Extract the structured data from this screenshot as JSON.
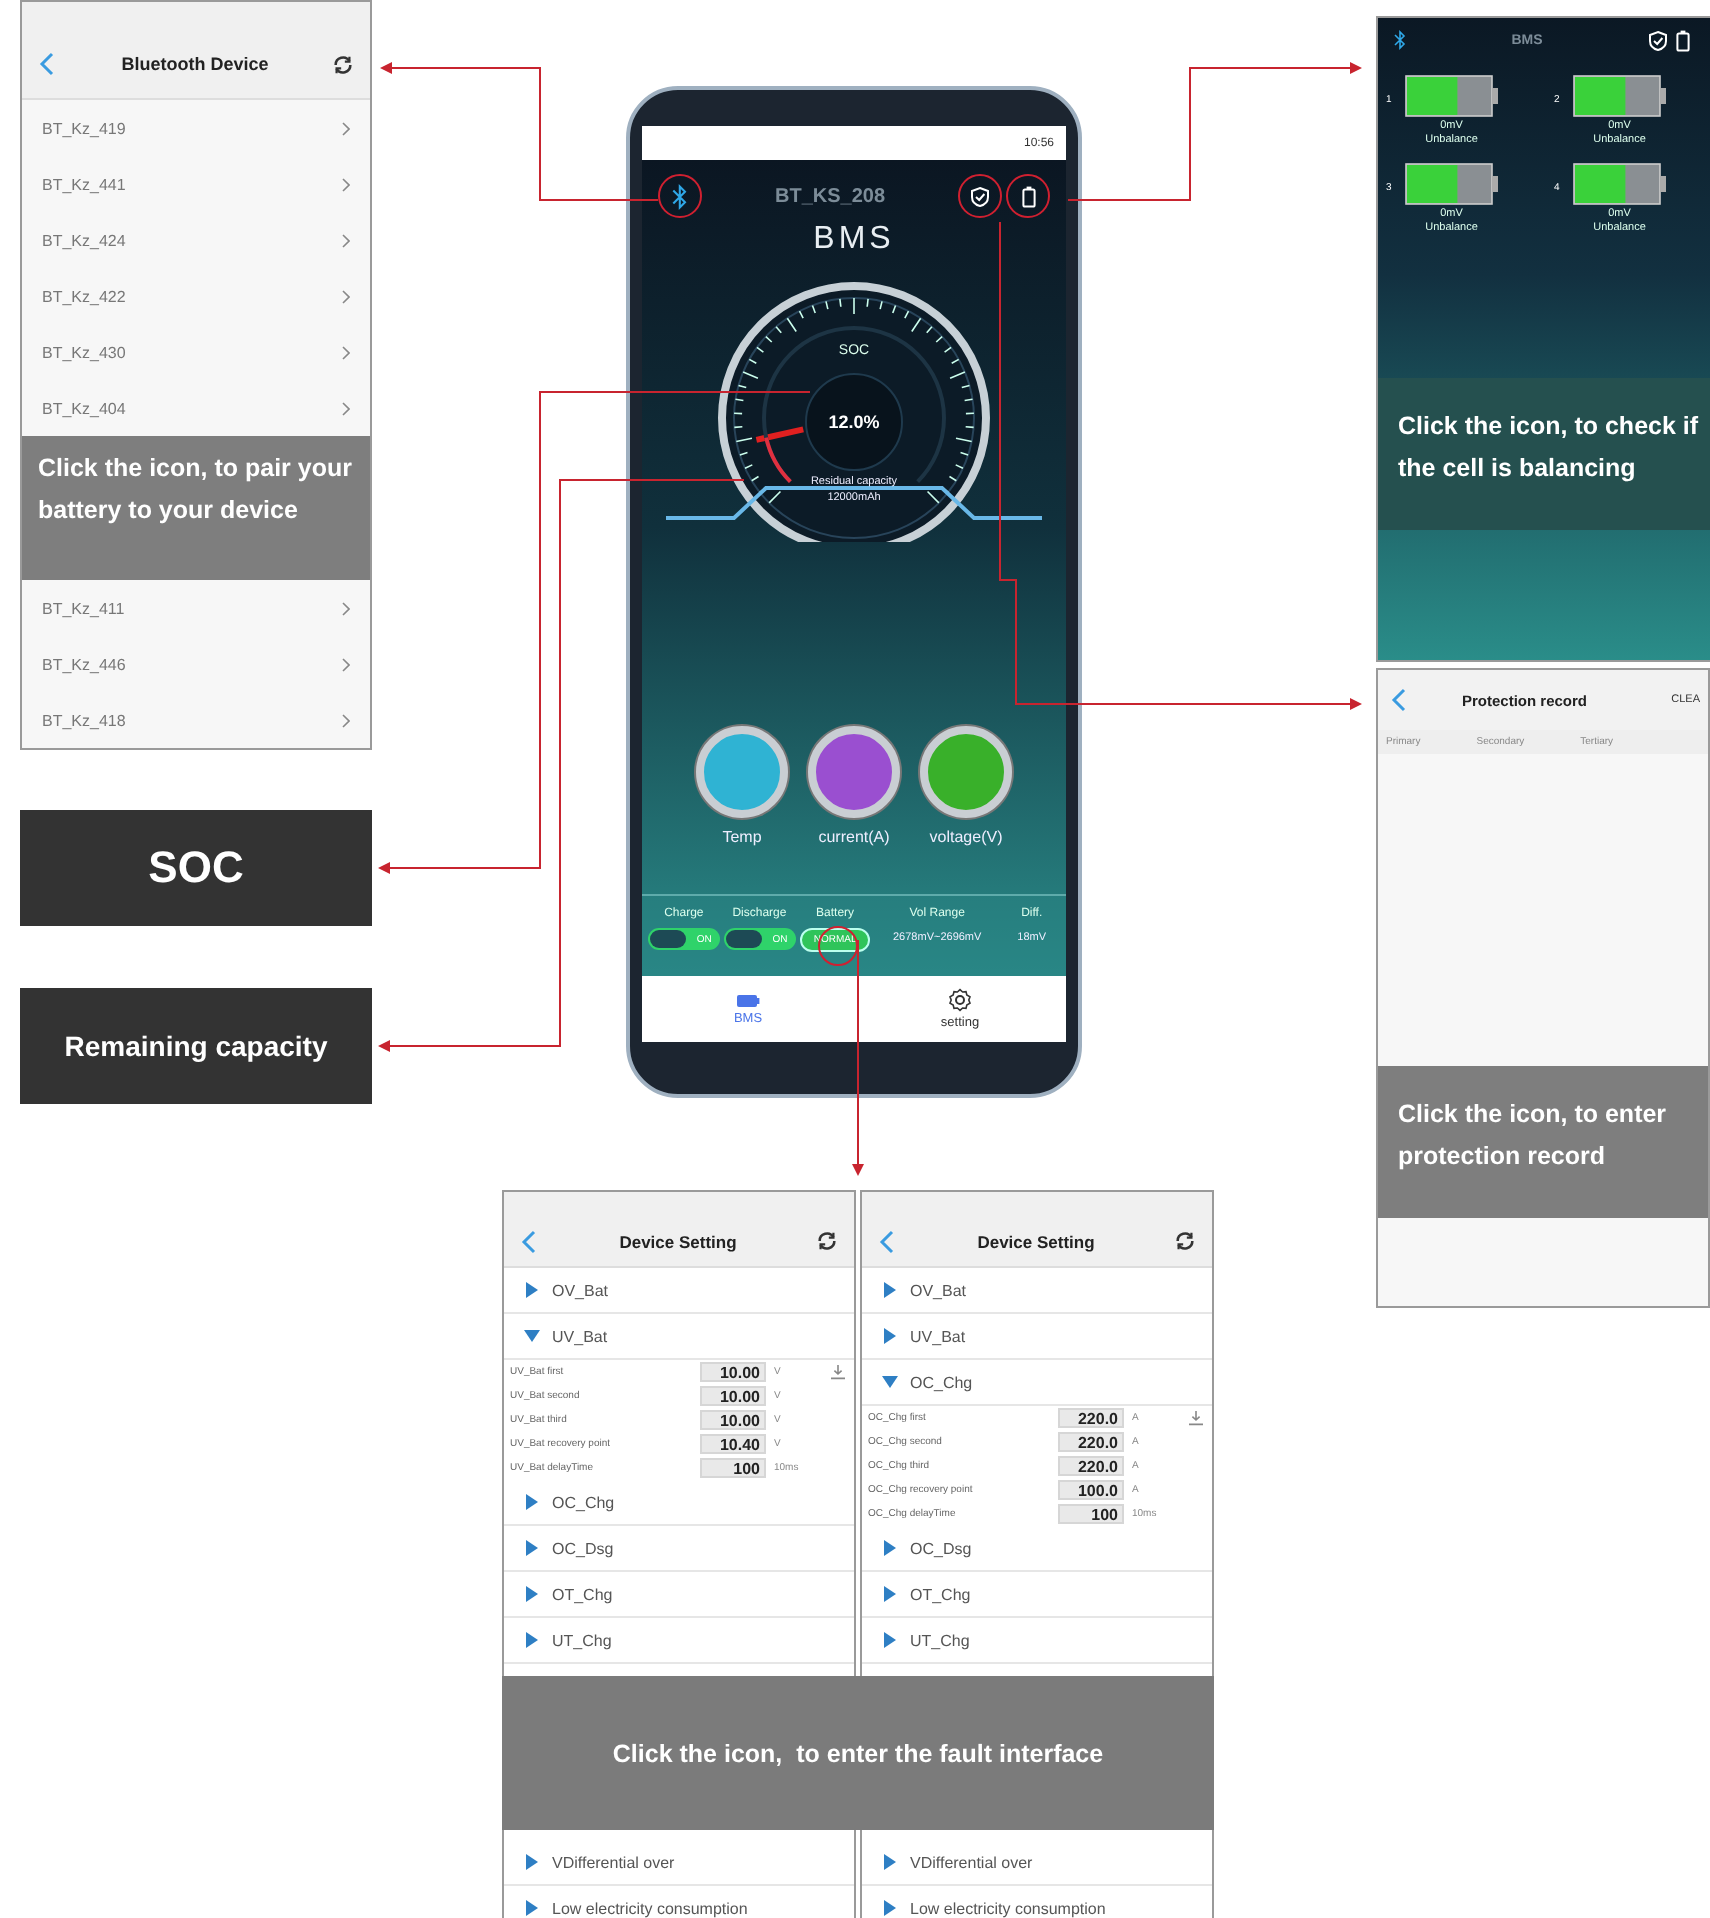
{
  "bluetooth_panel": {
    "title": "Bluetooth Device",
    "devices_top": [
      "BT_Kz_419",
      "BT_Kz_441",
      "BT_Kz_424",
      "BT_Kz_422",
      "BT_Kz_430",
      "BT_Kz_404"
    ],
    "caption": "Click the icon, to pair your battery to your device",
    "devices_bottom": [
      "BT_Kz_411",
      "BT_Kz_446",
      "BT_Kz_418"
    ]
  },
  "phone": {
    "status_time": "10:56",
    "device_name": "BT_KS_208",
    "title": "BMS",
    "gauge": {
      "label": "SOC",
      "value": "12.0%",
      "level": 0.12,
      "capacity_label": "Residual capacity",
      "capacity": "12000mAh"
    },
    "meters": [
      {
        "label": "Temp",
        "color": "#2fb3d3"
      },
      {
        "label": "current(A)",
        "color": "#9a4fd0"
      },
      {
        "label": "voltage(V)",
        "color": "#39b02a"
      }
    ],
    "status": [
      {
        "label": "Charge",
        "kind": "toggle",
        "on": true,
        "value": "ON"
      },
      {
        "label": "Discharge",
        "kind": "toggle",
        "on": true,
        "value": "ON"
      },
      {
        "label": "Battery",
        "kind": "badge",
        "value": "NORMAL"
      },
      {
        "label": "Vol Range",
        "kind": "text",
        "value": "2678mV~2696mV"
      },
      {
        "label": "Diff.",
        "kind": "text",
        "value": "18mV"
      }
    ],
    "nav": [
      {
        "label": "BMS",
        "kind": "bms",
        "selected": true
      },
      {
        "label": "setting",
        "kind": "setting",
        "selected": false
      }
    ]
  },
  "callouts": [
    "SOC",
    "Remaining capacity"
  ],
  "balance_panel": {
    "title": "BMS",
    "cells": [
      {
        "index": "1",
        "reading": "0mV",
        "status": "Unbalance",
        "level": 0.6
      },
      {
        "index": "2",
        "reading": "0mV",
        "status": "Unbalance",
        "level": 0.6
      },
      {
        "index": "3",
        "reading": "0mV",
        "status": "Unbalance",
        "level": 0.6
      },
      {
        "index": "4",
        "reading": "0mV",
        "status": "Unbalance",
        "level": 0.6
      }
    ],
    "caption": "Click the icon, to check if the cell is balancing"
  },
  "protection_panel": {
    "title": "Protection record",
    "action": "CLEA",
    "columns": [
      "Primary",
      "Secondary",
      "Tertiary"
    ],
    "caption": "Click the icon, to enter protection record"
  },
  "settings_panels": [
    {
      "title": "Device Setting",
      "groups_top": [
        {
          "label": "OV_Bat",
          "expanded": false
        },
        {
          "label": "UV_Bat",
          "expanded": true,
          "params": [
            {
              "name": "UV_Bat first",
              "value": "10.00",
              "unit": "V"
            },
            {
              "name": "UV_Bat second",
              "value": "10.00",
              "unit": "V"
            },
            {
              "name": "UV_Bat third",
              "value": "10.00",
              "unit": "V"
            },
            {
              "name": "UV_Bat recovery point",
              "value": "10.40",
              "unit": "V"
            },
            {
              "name": "UV_Bat delayTime",
              "value": "100",
              "unit": "10ms"
            }
          ]
        },
        {
          "label": "OC_Chg",
          "expanded": false
        },
        {
          "label": "OC_Dsg",
          "expanded": false
        },
        {
          "label": "OT_Chg",
          "expanded": false
        },
        {
          "label": "UT_Chg",
          "expanded": false
        }
      ],
      "groups_bottom": [
        {
          "label": "VDifferential over",
          "expanded": false
        },
        {
          "label": "Low electricity consumption",
          "expanded": false
        }
      ]
    },
    {
      "title": "Device Setting",
      "groups_top": [
        {
          "label": "OV_Bat",
          "expanded": false
        },
        {
          "label": "UV_Bat",
          "expanded": false
        },
        {
          "label": "OC_Chg",
          "expanded": true,
          "params": [
            {
              "name": "OC_Chg first",
              "value": "220.0",
              "unit": "A"
            },
            {
              "name": "OC_Chg second",
              "value": "220.0",
              "unit": "A"
            },
            {
              "name": "OC_Chg third",
              "value": "220.0",
              "unit": "A"
            },
            {
              "name": "OC_Chg recovery point",
              "value": "100.0",
              "unit": "A"
            },
            {
              "name": "OC_Chg delayTime",
              "value": "100",
              "unit": "10ms"
            }
          ]
        },
        {
          "label": "OC_Dsg",
          "expanded": false
        },
        {
          "label": "OT_Chg",
          "expanded": false
        },
        {
          "label": "UT_Chg",
          "expanded": false
        }
      ],
      "groups_bottom": [
        {
          "label": "VDifferential over",
          "expanded": false
        },
        {
          "label": "Low electricity consumption",
          "expanded": false
        }
      ]
    }
  ],
  "fault_caption": "Click the icon,  to enter the fault interface"
}
